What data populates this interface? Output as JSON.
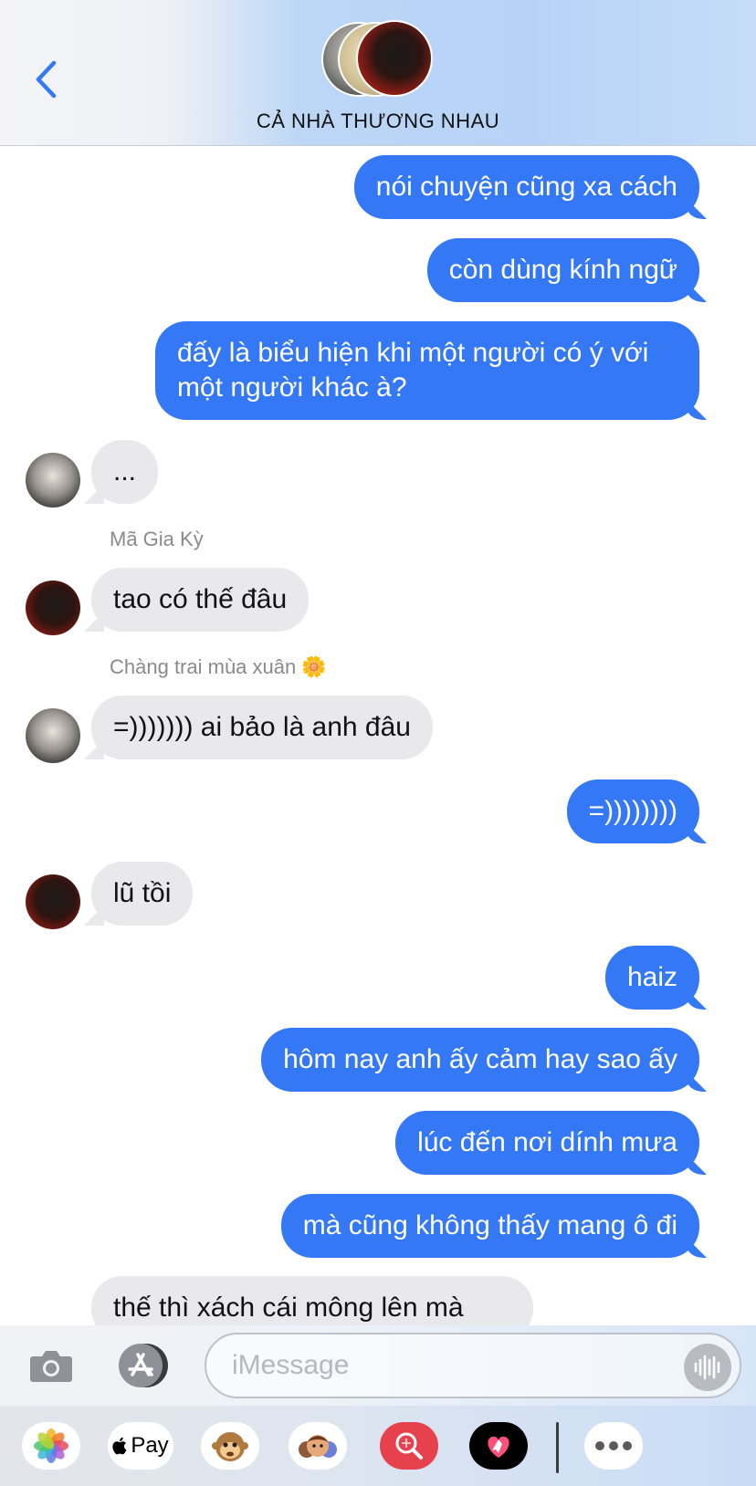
{
  "header": {
    "title": "CẢ NHÀ THƯƠNG NHAU",
    "back_icon": "chevron-left-icon"
  },
  "messages": [
    {
      "dir": "out",
      "text": "nói chuyện cũng xa cách"
    },
    {
      "dir": "out",
      "text": "còn dùng kính ngữ"
    },
    {
      "dir": "out",
      "text": "đấy là biểu hiện khi một người có ý với một người khác à?"
    },
    {
      "dir": "in",
      "text": "..."
    },
    {
      "sender": "Mã Gia Kỳ"
    },
    {
      "dir": "in",
      "text": "tao có thế đâu"
    },
    {
      "sender": "Chàng trai mùa xuân 🌼"
    },
    {
      "dir": "in",
      "text": "=))))))) ai bảo là anh đâu"
    },
    {
      "dir": "out",
      "text": "=))))))))"
    },
    {
      "dir": "in",
      "text": "lũ tồi"
    },
    {
      "dir": "out",
      "text": "haiz"
    },
    {
      "dir": "out",
      "text": "hôm nay anh ấy cảm hay sao ấy"
    },
    {
      "dir": "out",
      "text": "lúc đến nơi dính mưa"
    },
    {
      "dir": "out",
      "text": "mà cũng không thấy mang ô đi"
    },
    {
      "dir": "in",
      "text": "thế thì xách cái mông lên mà"
    }
  ],
  "input": {
    "placeholder": "iMessage",
    "value": ""
  },
  "app_drawer": {
    "apple_pay_label": "Pay",
    "items": [
      "photos-icon",
      "apple-pay-icon",
      "animoji-icon",
      "memoji-icon",
      "image-search-icon",
      "digital-touch-icon",
      "more-icon"
    ]
  },
  "colors": {
    "outgoing_bubble": "#3478f6",
    "incoming_bubble": "#e9e9eb",
    "accent": "#3478f6"
  }
}
